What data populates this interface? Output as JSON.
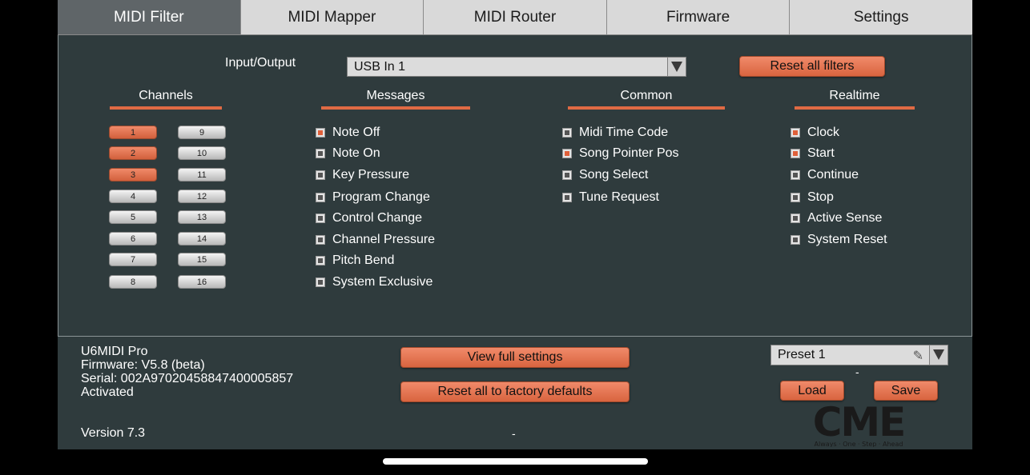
{
  "tabs": [
    "MIDI Filter",
    "MIDI Mapper",
    "MIDI Router",
    "Firmware",
    "Settings"
  ],
  "filter": {
    "io_label": "Input/Output",
    "io_value": "USB In 1",
    "reset_filters": "Reset all filters",
    "headings": {
      "channels": "Channels",
      "messages": "Messages",
      "common": "Common",
      "realtime": "Realtime"
    },
    "channels": [
      {
        "label": "1",
        "on": true
      },
      {
        "label": "2",
        "on": true
      },
      {
        "label": "3",
        "on": true
      },
      {
        "label": "4",
        "on": false
      },
      {
        "label": "5",
        "on": false
      },
      {
        "label": "6",
        "on": false
      },
      {
        "label": "7",
        "on": false
      },
      {
        "label": "8",
        "on": false
      },
      {
        "label": "9",
        "on": false
      },
      {
        "label": "10",
        "on": false
      },
      {
        "label": "11",
        "on": false
      },
      {
        "label": "12",
        "on": false
      },
      {
        "label": "13",
        "on": false
      },
      {
        "label": "14",
        "on": false
      },
      {
        "label": "15",
        "on": false
      },
      {
        "label": "16",
        "on": false
      }
    ],
    "messages": [
      {
        "label": "Note Off",
        "on": true
      },
      {
        "label": "Note On",
        "on": false
      },
      {
        "label": "Key Pressure",
        "on": false
      },
      {
        "label": "Program Change",
        "on": false
      },
      {
        "label": "Control Change",
        "on": false
      },
      {
        "label": "Channel Pressure",
        "on": false
      },
      {
        "label": "Pitch Bend",
        "on": false
      },
      {
        "label": "System Exclusive",
        "on": false
      }
    ],
    "common": [
      {
        "label": "Midi Time Code",
        "on": false
      },
      {
        "label": "Song Pointer Pos",
        "on": true
      },
      {
        "label": "Song Select",
        "on": false
      },
      {
        "label": "Tune Request",
        "on": false
      }
    ],
    "realtime": [
      {
        "label": "Clock",
        "on": true
      },
      {
        "label": "Start",
        "on": true
      },
      {
        "label": "Continue",
        "on": false
      },
      {
        "label": "Stop",
        "on": false
      },
      {
        "label": "Active Sense",
        "on": false
      },
      {
        "label": "System Reset",
        "on": false
      }
    ]
  },
  "device": {
    "name": "U6MIDI Pro",
    "firmware": "Firmware: V5.8 (beta)",
    "serial": "Serial: 002A97020458847400005857",
    "status": "Activated",
    "version": "Version 7.3"
  },
  "buttons": {
    "view_full_settings": "View full settings",
    "factory_reset": "Reset all to factory defaults",
    "load": "Load",
    "save": "Save"
  },
  "preset": {
    "value": "Preset 1",
    "sub": "-"
  },
  "footer_dash": "-",
  "logo": {
    "text": "CME",
    "tagline": "Always · One · Step · Ahead",
    "color": "#1a1a1a",
    "dot_color": "#e0603a"
  },
  "colors": {
    "accent": "#e0603a",
    "panel": "#2f3b3d",
    "tab_active": "#5f6568",
    "tab_inactive": "#d9d9d9"
  }
}
